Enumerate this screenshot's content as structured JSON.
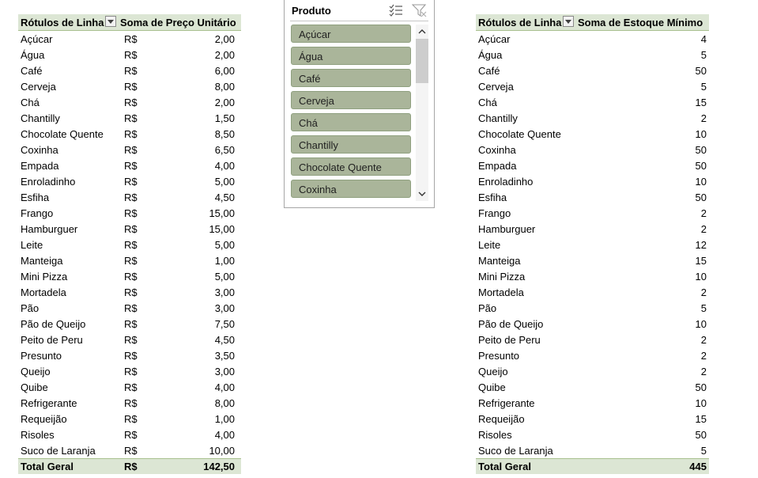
{
  "pivot_left": {
    "header_label": "Rótulos de Linha",
    "header_value": "Soma de Preço Unitário",
    "currency": "R$",
    "rows": [
      {
        "label": "Açúcar",
        "value": "2,00"
      },
      {
        "label": "Água",
        "value": "2,00"
      },
      {
        "label": "Café",
        "value": "6,00"
      },
      {
        "label": "Cerveja",
        "value": "8,00"
      },
      {
        "label": "Chá",
        "value": "2,00"
      },
      {
        "label": "Chantilly",
        "value": "1,50"
      },
      {
        "label": "Chocolate Quente",
        "value": "8,50"
      },
      {
        "label": "Coxinha",
        "value": "6,50"
      },
      {
        "label": "Empada",
        "value": "4,00"
      },
      {
        "label": "Enroladinho",
        "value": "5,00"
      },
      {
        "label": "Esfiha",
        "value": "4,50"
      },
      {
        "label": "Frango",
        "value": "15,00"
      },
      {
        "label": "Hamburguer",
        "value": "15,00"
      },
      {
        "label": "Leite",
        "value": "5,00"
      },
      {
        "label": "Manteiga",
        "value": "1,00"
      },
      {
        "label": "Mini Pizza",
        "value": "5,00"
      },
      {
        "label": "Mortadela",
        "value": "3,00"
      },
      {
        "label": "Pão",
        "value": "3,00"
      },
      {
        "label": "Pão de Queijo",
        "value": "7,50"
      },
      {
        "label": "Peito de Peru",
        "value": "4,50"
      },
      {
        "label": "Presunto",
        "value": "3,50"
      },
      {
        "label": "Queijo",
        "value": "3,00"
      },
      {
        "label": "Quibe",
        "value": "4,00"
      },
      {
        "label": "Refrigerante",
        "value": "8,00"
      },
      {
        "label": "Requeijão",
        "value": "1,00"
      },
      {
        "label": "Risoles",
        "value": "4,00"
      },
      {
        "label": "Suco de Laranja",
        "value": "10,00"
      }
    ],
    "total_label": "Total Geral",
    "total_value": "142,50"
  },
  "slicer": {
    "title": "Produto",
    "items": [
      "Açúcar",
      "Água",
      "Café",
      "Cerveja",
      "Chá",
      "Chantilly",
      "Chocolate Quente",
      "Coxinha"
    ]
  },
  "pivot_right": {
    "header_label": "Rótulos de Linha",
    "header_value": "Soma de Estoque Mínimo",
    "rows": [
      {
        "label": "Açúcar",
        "value": "4"
      },
      {
        "label": "Água",
        "value": "5"
      },
      {
        "label": "Café",
        "value": "50"
      },
      {
        "label": "Cerveja",
        "value": "5"
      },
      {
        "label": "Chá",
        "value": "15"
      },
      {
        "label": "Chantilly",
        "value": "2"
      },
      {
        "label": "Chocolate Quente",
        "value": "10"
      },
      {
        "label": "Coxinha",
        "value": "50"
      },
      {
        "label": "Empada",
        "value": "50"
      },
      {
        "label": "Enroladinho",
        "value": "10"
      },
      {
        "label": "Esfiha",
        "value": "50"
      },
      {
        "label": "Frango",
        "value": "2"
      },
      {
        "label": "Hamburguer",
        "value": "2"
      },
      {
        "label": "Leite",
        "value": "12"
      },
      {
        "label": "Manteiga",
        "value": "15"
      },
      {
        "label": "Mini Pizza",
        "value": "10"
      },
      {
        "label": "Mortadela",
        "value": "2"
      },
      {
        "label": "Pão",
        "value": "5"
      },
      {
        "label": "Pão de Queijo",
        "value": "10"
      },
      {
        "label": "Peito de Peru",
        "value": "2"
      },
      {
        "label": "Presunto",
        "value": "2"
      },
      {
        "label": "Queijo",
        "value": "2"
      },
      {
        "label": "Quibe",
        "value": "50"
      },
      {
        "label": "Refrigerante",
        "value": "10"
      },
      {
        "label": "Requeijão",
        "value": "15"
      },
      {
        "label": "Risoles",
        "value": "50"
      },
      {
        "label": "Suco de Laranja",
        "value": "5"
      }
    ],
    "total_label": "Total Geral",
    "total_value": "445"
  },
  "colors": {
    "header_bg": "#dce6d4",
    "slicer_item_bg": "#aab59a"
  },
  "icons": [
    "dropdown-arrow-icon",
    "multi-select-icon",
    "clear-filter-icon",
    "scroll-up-icon",
    "scroll-down-icon"
  ]
}
